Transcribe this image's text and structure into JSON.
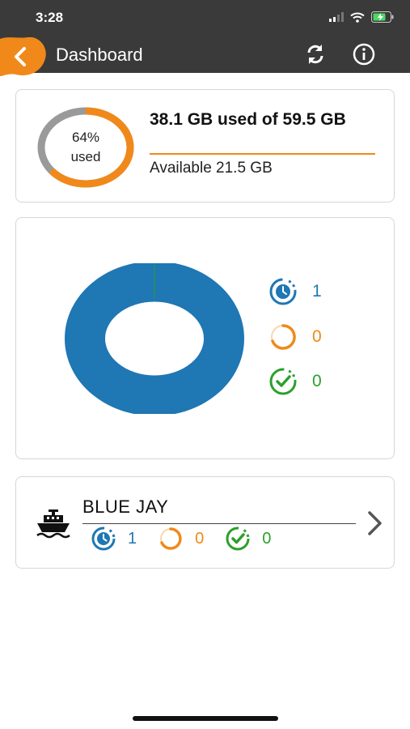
{
  "status_bar": {
    "time": "3:28"
  },
  "app_bar": {
    "title": "Dashboard"
  },
  "storage": {
    "percent_label": "64%",
    "used_label": "used",
    "used_text": "38.1 GB used of 59.5 GB",
    "available_text": "Available 21.5 GB",
    "used_fraction": 0.64
  },
  "summary": {
    "legend": [
      {
        "status": "pending",
        "icon": "clock-icon",
        "value": "1",
        "color": "#1f77b4"
      },
      {
        "status": "in-progress",
        "icon": "progress-icon",
        "value": "0",
        "color": "#f0891a"
      },
      {
        "status": "completed",
        "icon": "check-icon",
        "value": "0",
        "color": "#2ca02c"
      }
    ],
    "chart_data": {
      "type": "pie",
      "categories": [
        "pending",
        "in-progress",
        "completed"
      ],
      "values": [
        1,
        0,
        0
      ]
    }
  },
  "vessel": {
    "name": "BLUE JAY",
    "stats": [
      {
        "status": "pending",
        "icon": "clock-icon",
        "value": "1",
        "color": "#1f77b4"
      },
      {
        "status": "in-progress",
        "icon": "progress-icon",
        "value": "0",
        "color": "#f0891a"
      },
      {
        "status": "completed",
        "icon": "check-icon",
        "value": "0",
        "color": "#2ca02c"
      }
    ]
  },
  "colors": {
    "header_bg": "#3a3a3a",
    "accent_orange": "#f0891a",
    "pending_blue": "#1f77b4",
    "completed_green": "#2ca02c",
    "ring_gray": "#9a9a9a"
  }
}
